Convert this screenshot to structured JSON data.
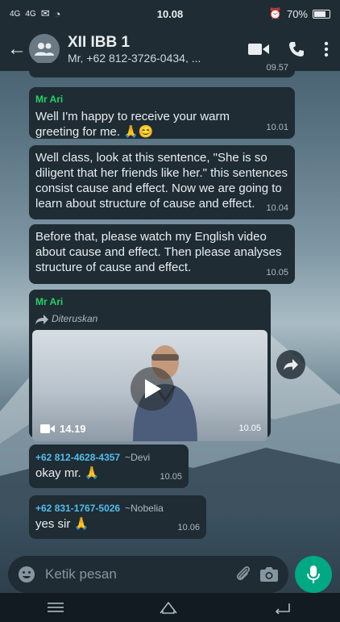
{
  "status": {
    "time": "10.08",
    "battery": "70%",
    "signal1": "4G",
    "signal2": "4G"
  },
  "header": {
    "title": "XII IBB 1",
    "subtitle": "Mr, +62 812-3726-0434, ..."
  },
  "messages": {
    "top_partial_time": "09.57",
    "m1": {
      "sender": "Mr Ari",
      "text": "Well I'm happy to receive your warm greeting for me. 🙏😊",
      "time": "10.01"
    },
    "m2": {
      "text": "Well class, look at this sentence, \"She is so diligent that her friends like her.\" this sentences consist cause and effect. Now we are going to learn about structure of cause and effect.",
      "time": "10.04"
    },
    "m3": {
      "text": "Before that, please watch my English video about cause and effect. Then please analyses structure of cause and effect.",
      "time": "10.05"
    },
    "m4": {
      "sender": "Mr Ari",
      "forwarded": "Diteruskan",
      "duration": "14.19",
      "time": "10.05"
    },
    "m5": {
      "phone": "+62 812-4628-4357",
      "nick": "~Devi",
      "text": "okay mr. 🙏",
      "time": "10.05"
    },
    "m6": {
      "phone": "+62 831-1767-5026",
      "nick": "~Nobelia",
      "text": "yes sir 🙏",
      "time": "10.06"
    }
  },
  "input": {
    "placeholder": "Ketik pesan"
  },
  "colors": {
    "accent": "#00a884",
    "sender": "#25d366",
    "phone": "#53bdeb",
    "bubble": "#1f2c34"
  },
  "icons": [
    "back-arrow-icon",
    "group-icon",
    "video-call-icon",
    "phone-icon",
    "more-icon",
    "forward-icon",
    "play-icon",
    "video-icon",
    "share-icon",
    "emoji-icon",
    "attach-icon",
    "camera-icon",
    "mic-icon",
    "menu-icon",
    "home-icon",
    "back-icon"
  ]
}
